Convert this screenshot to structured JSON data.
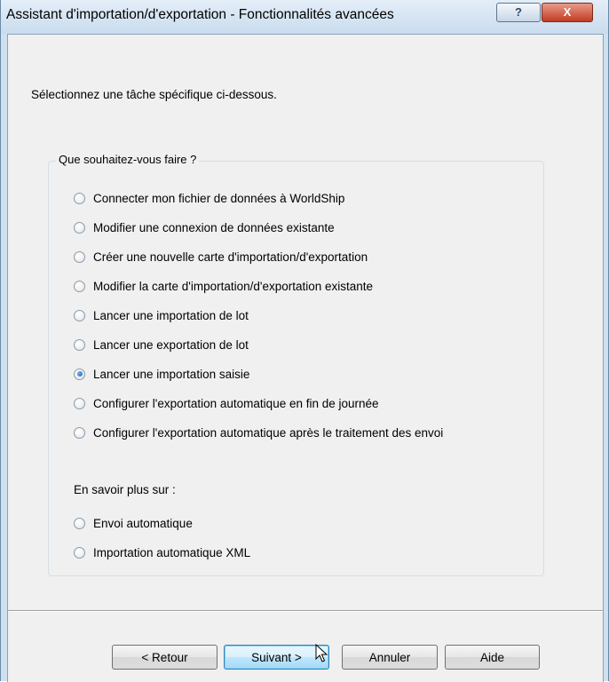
{
  "window": {
    "title": "Assistant d'importation/d'exportation - Fonctionnalités avancées",
    "help_label": "?",
    "close_label": "X"
  },
  "instruction": "Sélectionnez une tâche spécifique ci-dessous.",
  "group": {
    "label": "Que souhaitez-vous faire ?",
    "options": [
      {
        "label": "Connecter mon fichier de données à WorldShip",
        "checked": false
      },
      {
        "label": "Modifier une connexion de données existante",
        "checked": false
      },
      {
        "label": "Créer une nouvelle carte d'importation/d'exportation",
        "checked": false
      },
      {
        "label": "Modifier la carte d'importation/d'exportation existante",
        "checked": false
      },
      {
        "label": "Lancer une importation de lot",
        "checked": false
      },
      {
        "label": "Lancer une exportation de lot",
        "checked": false
      },
      {
        "label": "Lancer une importation saisie",
        "checked": true
      },
      {
        "label": "Configurer l'exportation automatique en fin de journée",
        "checked": false
      },
      {
        "label": "Configurer l'exportation automatique après le traitement des envoi",
        "checked": false
      }
    ],
    "learn_more_label": "En savoir plus sur :",
    "learn_more_options": [
      {
        "label": "Envoi automatique",
        "checked": false
      },
      {
        "label": "Importation automatique XML",
        "checked": false
      }
    ]
  },
  "buttons": {
    "back": "< Retour",
    "next": "Suivant >",
    "cancel": "Annuler",
    "help": "Aide"
  },
  "icons": {
    "help": "question-mark-icon",
    "close": "close-icon",
    "cursor": "mouse-pointer-icon"
  },
  "colors": {
    "titlebar": "#c9dcee",
    "client_bg": "#f0f0f0",
    "close_button": "#c23d22",
    "radio_selected": "#1a5fb4"
  }
}
